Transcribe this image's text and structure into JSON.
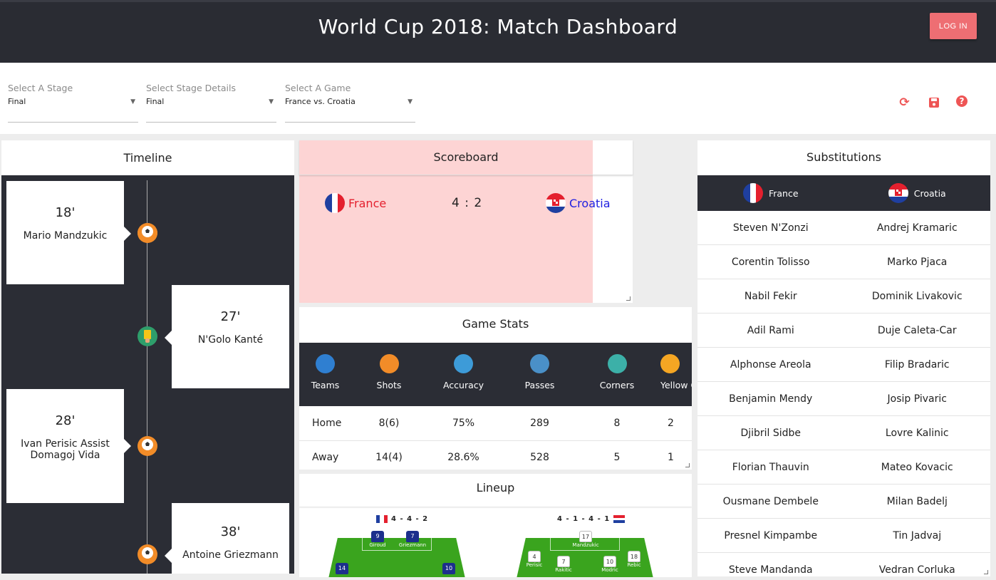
{
  "header": {
    "title": "World Cup 2018: Match Dashboard",
    "login_label": "LOG IN"
  },
  "filters": {
    "stage": {
      "label": "Select A Stage",
      "value": "Final"
    },
    "stage_details": {
      "label": "Select Stage Details",
      "value": "Final"
    },
    "game": {
      "label": "Select A Game",
      "value": "France vs. Croatia"
    }
  },
  "toolbar": {
    "refresh_icon": "refresh-icon",
    "save_icon": "save-icon",
    "help_icon": "help-icon"
  },
  "timeline": {
    "title": "Timeline",
    "events": [
      {
        "minute": "18'",
        "text": "Mario Mandzukic",
        "icon": "goal-ball-icon"
      },
      {
        "minute": "27'",
        "text": "N'Golo Kanté",
        "icon": "yellow-card-icon"
      },
      {
        "minute": "28'",
        "text": "Ivan Perisic Assist Domagoj Vida",
        "icon": "goal-ball-icon"
      },
      {
        "minute": "38'",
        "text": "Antoine Griezmann",
        "icon": "goal-ball-icon"
      }
    ]
  },
  "scoreboard": {
    "title": "Scoreboard",
    "home": "France",
    "away": "Croatia",
    "score": "4 : 2",
    "home_color": "#e4202e",
    "away_color": "#2020e0"
  },
  "stats": {
    "title": "Game Stats",
    "columns": [
      "Teams",
      "Shots",
      "Accuracy",
      "Passes",
      "Corners",
      "Yellow Cards"
    ],
    "rows": [
      [
        "Home",
        "8(6)",
        "75%",
        "289",
        "8",
        "2"
      ],
      [
        "Away",
        "14(4)",
        "28.6%",
        "528",
        "5",
        "1"
      ]
    ]
  },
  "lineup": {
    "title": "Lineup",
    "home_formation": "4 - 4 - 2",
    "away_formation": "4 - 1 - 4 - 1",
    "home_players": [
      {
        "num": "9",
        "name": "Giroud"
      },
      {
        "num": "7",
        "name": "Griezmann"
      },
      {
        "num": "14",
        "name": ""
      },
      {
        "num": "10",
        "name": ""
      }
    ],
    "away_players": [
      {
        "num": "17",
        "name": "Mandzukic"
      },
      {
        "num": "4",
        "name": "Perisic"
      },
      {
        "num": "7",
        "name": "Rakitic"
      },
      {
        "num": "10",
        "name": "Modric"
      },
      {
        "num": "18",
        "name": "Rebic"
      }
    ]
  },
  "substitutions": {
    "title": "Substitutions",
    "home_team": "France",
    "away_team": "Croatia",
    "rows": [
      [
        "Steven N'Zonzi",
        "Andrej Kramaric"
      ],
      [
        "Corentin Tolisso",
        "Marko Pjaca"
      ],
      [
        "Nabil Fekir",
        "Dominik Livakovic"
      ],
      [
        "Adil Rami",
        "Duje Caleta-Car"
      ],
      [
        "Alphonse Areola",
        "Filip Bradaric"
      ],
      [
        "Benjamin Mendy",
        "Josip Pivaric"
      ],
      [
        "Djibril Sidbe",
        "Lovre Kalinic"
      ],
      [
        "Florian Thauvin",
        "Mateo Kovacic"
      ],
      [
        "Ousmane Dembele",
        "Milan Badelj"
      ],
      [
        "Presnel Kimpambe",
        "Tin Jadvaj"
      ],
      [
        "Steve Mandanda",
        "Vedran Corluka"
      ]
    ]
  }
}
